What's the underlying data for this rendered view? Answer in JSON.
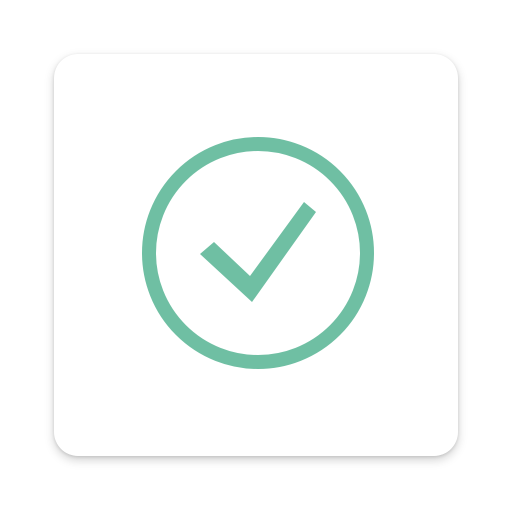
{
  "app_icon": {
    "icon": "check-circle-icon",
    "colors": {
      "tile_background": "#ffffff",
      "accent": "#6fbfa3"
    }
  }
}
